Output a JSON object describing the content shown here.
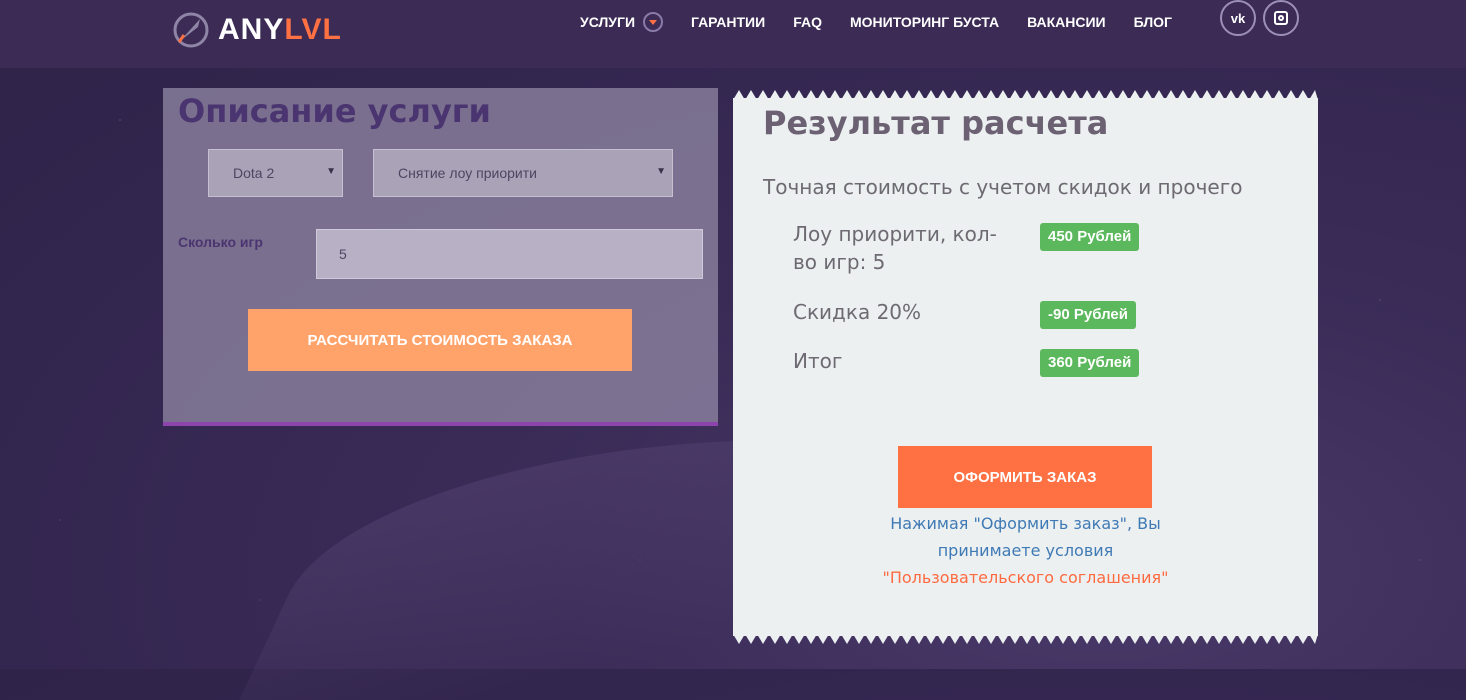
{
  "brand": {
    "name_part1": "ANY",
    "name_part2": "LVL",
    "accent_color": "#ff7043"
  },
  "nav": {
    "items": [
      {
        "label": "УСЛУГИ",
        "has_dropdown": true
      },
      {
        "label": "ГАРАНТИИ"
      },
      {
        "label": "FAQ"
      },
      {
        "label": "МОНИТОРИНГ БУСТА"
      },
      {
        "label": "ВАКАНСИИ"
      },
      {
        "label": "БЛОГ"
      }
    ],
    "social": [
      {
        "icon": "vk-icon",
        "glyph": "vk"
      },
      {
        "icon": "instagram-icon"
      }
    ]
  },
  "service": {
    "title": "Описание услуги",
    "game_select": "Dota 2",
    "service_select": "Снятие лоу приорити",
    "games_label": "Сколько игр",
    "games_value": "5",
    "calc_button": "РАССЧИТАТЬ СТОИМОСТЬ ЗАКАЗА",
    "button_color": "#ffa36b"
  },
  "result": {
    "title": "Результат расчета",
    "subtitle": "Точная стоимость с учетом скидок и прочего",
    "rows": [
      {
        "label": "Лоу приорити, кол-во игр: 5",
        "value": "450 Рублей"
      },
      {
        "label": "Скидка 20%",
        "value": "-90 Рублей"
      },
      {
        "label": "Итог",
        "value": "360 Рублей"
      }
    ],
    "badge_color": "#5cb85c",
    "order_button": "ОФОРМИТЬ ЗАКАЗ",
    "terms_text": "Нажимая \"Оформить заказ\", Вы принимаете условия",
    "terms_link": "\"Пользовательского соглашения\""
  }
}
